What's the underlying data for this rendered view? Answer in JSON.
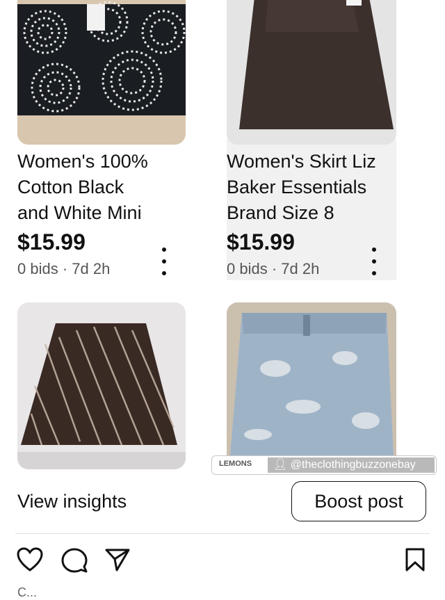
{
  "listings": [
    {
      "title": "Women's 100%\nCotton Black\nand White Mini",
      "price": "$15.99",
      "meta": "0 bids · 7d 2h"
    },
    {
      "title": "Women's Skirt Liz\nBaker Essentials\nBrand Size 8",
      "price": "$15.99",
      "meta": "0 bids · 7d 2h"
    }
  ],
  "watermark": {
    "logo_text": "LEMONS",
    "username": "@theclothingbuzzonebay"
  },
  "footer": {
    "insights_label": "View insights",
    "boost_label": "Boost post",
    "caption": "C..."
  },
  "icons": {
    "like": "heart-icon",
    "comment": "comment-icon",
    "share": "send-icon",
    "save": "bookmark-icon",
    "more": "more-vertical-icon"
  }
}
